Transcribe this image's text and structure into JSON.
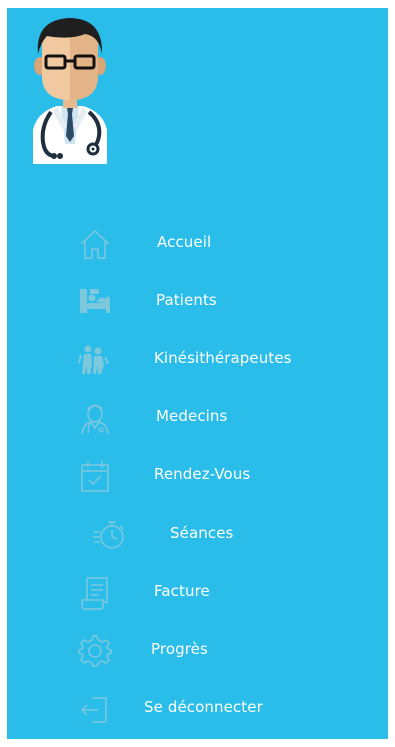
{
  "sidebar": {
    "bg_color": "#2bbde9",
    "icon_color": "#7ec8de",
    "label_color": "#ffffff",
    "avatar_icon": "doctor-avatar",
    "items": [
      {
        "label": "Accueil",
        "icon": "home-icon"
      },
      {
        "label": "Patients",
        "icon": "patient-bed-icon"
      },
      {
        "label": "Kinésithérapeutes",
        "icon": "physiotherapist-icon"
      },
      {
        "label": "Medecins",
        "icon": "doctor-icon"
      },
      {
        "label": "Rendez-Vous",
        "icon": "calendar-icon"
      },
      {
        "label": "Séances",
        "icon": "stopwatch-icon"
      },
      {
        "label": "Facture",
        "icon": "invoice-icon"
      },
      {
        "label": "Progrès",
        "icon": "gear-icon"
      },
      {
        "label": "Se déconnecter",
        "icon": "logout-icon"
      }
    ]
  }
}
